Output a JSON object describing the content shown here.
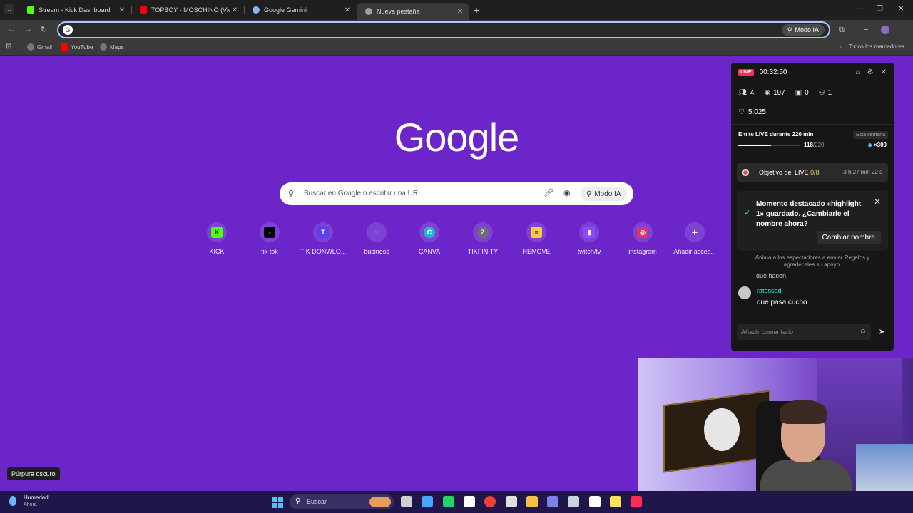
{
  "browser": {
    "tabs": [
      {
        "title": "Stream - Kick Dashboard",
        "favicon_color": "#53fc18"
      },
      {
        "title": "TOPBOY - MOSCHINO (Video Ofi",
        "favicon_color": "#ff0000"
      },
      {
        "title": "Google Gemini",
        "favicon_color": "#8ab4f8"
      },
      {
        "title": "Nueva pestaña",
        "favicon_color": "#9aa0a6",
        "active": true
      }
    ],
    "omnibox_value": "",
    "modo_ia_label": "Modo IA",
    "bookmarks": [
      {
        "label": "Gmail",
        "icon": "globe-icon"
      },
      {
        "label": "YouTube",
        "icon": "youtube-icon"
      },
      {
        "label": "Maps",
        "icon": "globe-icon"
      }
    ],
    "all_bookmarks_label": "Todos los marcadores"
  },
  "google": {
    "logo": "Google",
    "search_placeholder": "Buscar en Google o escribir una URL",
    "modo_ia_label": "Modo IA",
    "shortcuts": [
      {
        "label": "KICK",
        "glyph": "K",
        "bg": "#53fc18",
        "fg": "#000"
      },
      {
        "label": "tik tok",
        "glyph": "♪",
        "bg": "#000",
        "fg": "#fff"
      },
      {
        "label": "TIK DONWLO...",
        "glyph": "T",
        "bg": "#5b3df5",
        "fg": "#fff"
      },
      {
        "label": "business",
        "glyph": "∞",
        "bg": "#7e42d2",
        "fg": "#2f8cff"
      },
      {
        "label": "CANVA",
        "glyph": "C",
        "bg": "#1fb6d6",
        "fg": "#fff"
      },
      {
        "label": "TIKFINITY",
        "glyph": "Z",
        "bg": "#6d6d6d",
        "fg": "#fff"
      },
      {
        "label": "REMOVE",
        "glyph": "≡",
        "bg": "#f7c948",
        "fg": "#5a3a00"
      },
      {
        "label": "twitch/tv",
        "glyph": "▮",
        "bg": "#9146ff",
        "fg": "#fff"
      },
      {
        "label": "instagram",
        "glyph": "◎",
        "bg": "#e1306c",
        "fg": "#fff"
      },
      {
        "label": "Añadir acces...",
        "glyph": "+",
        "bg": "transparent",
        "fg": "#fff"
      }
    ]
  },
  "live_panel": {
    "badge": "LIVE",
    "time": "00:32:50",
    "stats": {
      "viewers": "4",
      "views": "197",
      "gifts": "0",
      "followers": "1"
    },
    "likes": "5.025",
    "goal_text": "Emite LIVE durante 220 min",
    "week_label": "Esta semana",
    "progress_current": "118",
    "progress_total": "/220",
    "progress_fraction": 0.536,
    "reward": "×300",
    "objective_label": "Objetivo del LIVE",
    "objective_count": "0/8",
    "objective_time": "3 h 27 min 22 s",
    "highlight_text": "Momento destacado «highlight 1» guardado. ¿Cambiarle el nombre ahora?",
    "rename_button": "Cambiar nombre",
    "hint": "Anima a los espectadores a enviar Regalos y agradéceles su apoyo.",
    "prev_message": "que hacen",
    "comment": {
      "user": "ratossad",
      "message": "que pasa cucho"
    },
    "input_placeholder": "Añadir comentario"
  },
  "theme_chip": "Púrpura oscuro",
  "taskbar": {
    "weather_title": "Humedad",
    "weather_sub": "Ahora",
    "search_placeholder": "Buscar",
    "apps": [
      {
        "name": "task-view-icon",
        "color": "#cfcfcf"
      },
      {
        "name": "copilot-icon",
        "color": "#4aa3ff"
      },
      {
        "name": "whatsapp-icon",
        "color": "#25d366"
      },
      {
        "name": "capcut-icon",
        "color": "#ffffff"
      },
      {
        "name": "chrome-icon",
        "color": "#ea4335"
      },
      {
        "name": "recorder-icon",
        "color": "#e0e0e0"
      },
      {
        "name": "file-explorer-icon",
        "color": "#f6c244"
      },
      {
        "name": "teams-icon",
        "color": "#7b83eb"
      },
      {
        "name": "steam-icon",
        "color": "#c7d5e0"
      },
      {
        "name": "capcut-alt-icon",
        "color": "#ffffff"
      },
      {
        "name": "sticky-notes-icon",
        "color": "#f7e35b"
      },
      {
        "name": "tiktok-icon",
        "color": "#fe2c55"
      }
    ]
  }
}
